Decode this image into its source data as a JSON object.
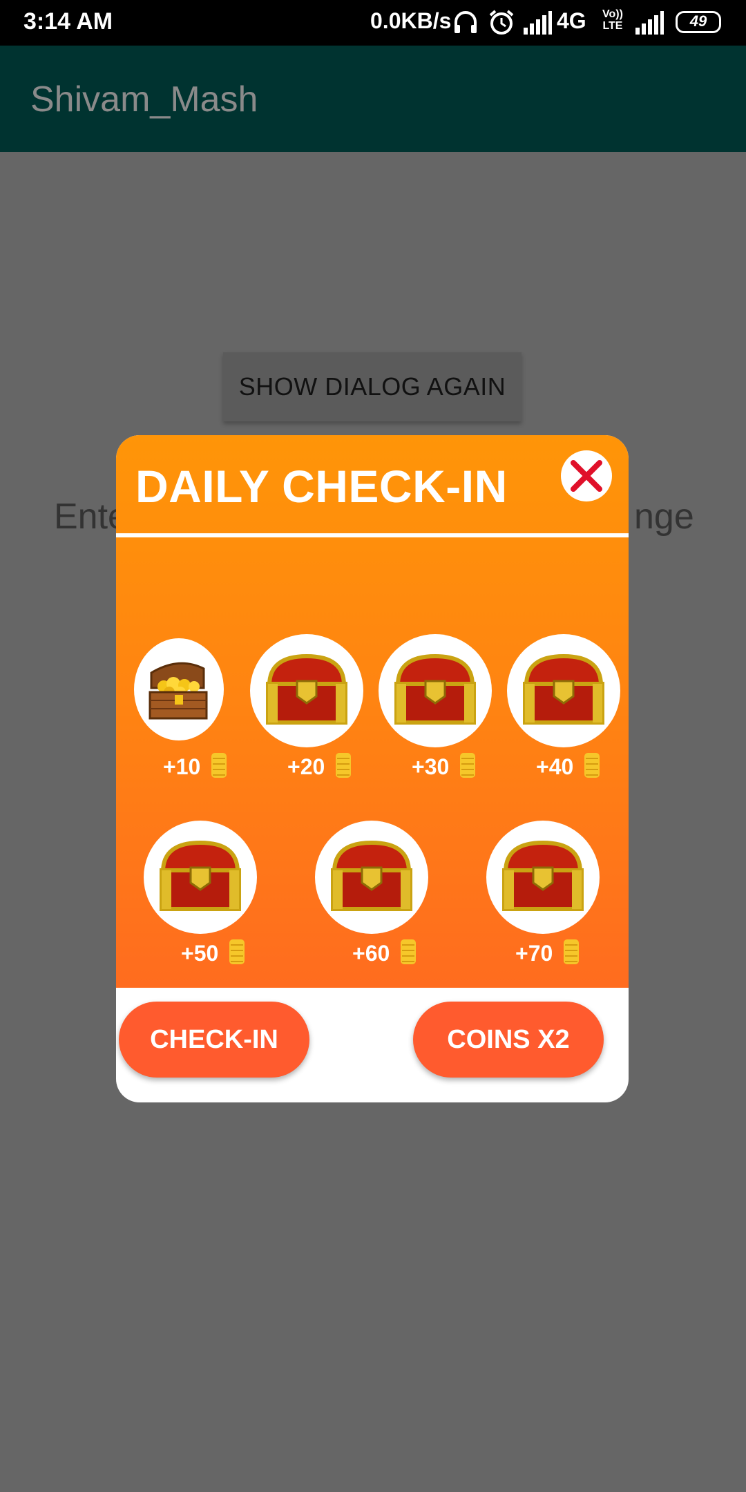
{
  "status_bar": {
    "time": "3:14 AM",
    "speed": "0.0KB/s",
    "network": "4G",
    "volte_top": "Vo))",
    "volte_bottom": "LTE",
    "battery": "49"
  },
  "app_bar": {
    "title": "Shivam_Mash"
  },
  "background": {
    "show_dialog_button": "SHOW DIALOG AGAIN",
    "text_left": "Ente",
    "text_right": "nge"
  },
  "dialog": {
    "title": "DAILY CHECK-IN",
    "rewards": [
      {
        "label": "+10",
        "icon": "open-gold-chest-icon"
      },
      {
        "label": "+20",
        "icon": "red-chest-icon"
      },
      {
        "label": "+30",
        "icon": "red-chest-icon"
      },
      {
        "label": "+40",
        "icon": "red-chest-icon"
      },
      {
        "label": "+50",
        "icon": "red-chest-icon"
      },
      {
        "label": "+60",
        "icon": "red-chest-icon"
      },
      {
        "label": "+70",
        "icon": "red-chest-icon"
      }
    ],
    "checkin_button": "CHECK-IN",
    "coins_button": "COINS X2"
  },
  "colors": {
    "app_bar": "#003330",
    "dialog_gradient_top": "#ff9508",
    "dialog_gradient_bottom": "#ff6c1f",
    "button": "#ff5b2e",
    "close_x": "#e0102a"
  }
}
